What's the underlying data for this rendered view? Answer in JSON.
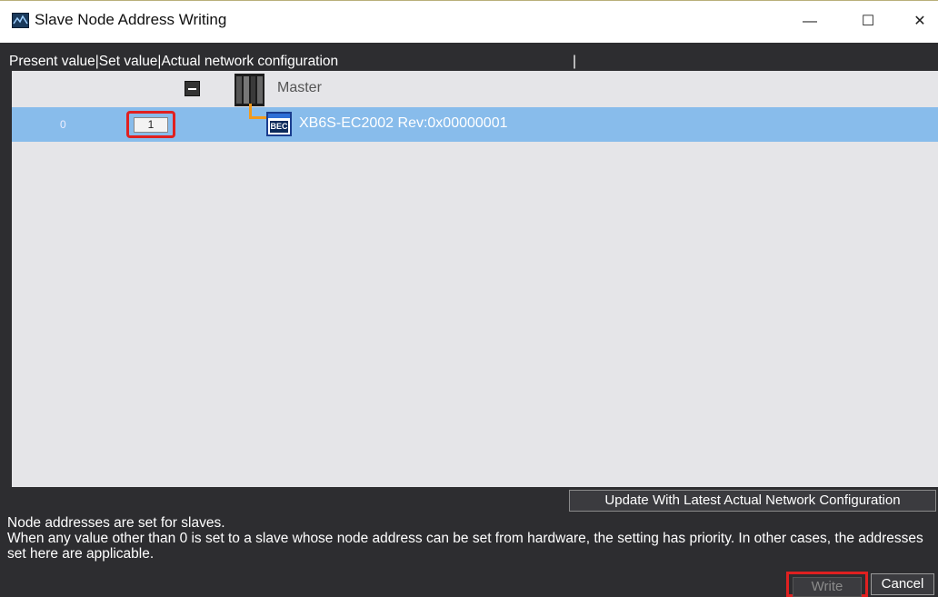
{
  "window": {
    "title": "Slave Node Address Writing",
    "icon": "app-icon",
    "controls": {
      "minimize": "—",
      "maximize": "☐",
      "close": "✕"
    }
  },
  "table": {
    "header": "Present value|Set value|Actual network configuration",
    "header_sep": "|",
    "master": {
      "label": "Master",
      "collapse_icon": "collapse-icon",
      "icon": "master-device-icon"
    },
    "slaves": [
      {
        "present_value": "0",
        "set_value": "1",
        "label": "XB6S-EC2002 Rev:0x00000001",
        "icon_text": "BEC"
      }
    ]
  },
  "buttons": {
    "update": "Update With Latest Actual Network Configuration",
    "write": "Write",
    "cancel": "Cancel"
  },
  "info": {
    "line1": "Node addresses are set for slaves.",
    "line2": "When any value other than 0 is set to a slave whose node address can be set from hardware, the setting has priority. In other cases, the addresses set here are applicable."
  },
  "colors": {
    "background": "#2d2d30",
    "grid": "#e5e5e8",
    "selected_row": "#88bceb",
    "highlight": "#e02020",
    "connector": "#f39a1b"
  }
}
